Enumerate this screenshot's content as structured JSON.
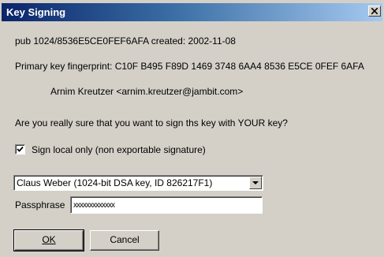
{
  "window": {
    "title": "Key Signing"
  },
  "key": {
    "pub_line": "pub 1024/8536E5CE0FEF6AFA created: 2002-11-08",
    "fingerprint_line": "Primary key fingerprint: C10F B495 F89D 1469 3748 6AA4 8536 E5CE 0FEF 6AFA",
    "user_id": "Arnim Kreutzer <arnim.kreutzer@jambit.com>"
  },
  "question": "Are you really sure that you want to sign ths key with YOUR key?",
  "local_only": {
    "label": "Sign local only (non exportable signature)",
    "checked": true
  },
  "signing_key": {
    "selected": "Claus Weber (1024-bit DSA key, ID 826217F1)"
  },
  "passphrase": {
    "label": "Passphrase",
    "value": "xxxxxxxxxxxxx"
  },
  "buttons": {
    "ok": "OK",
    "cancel": "Cancel"
  },
  "icons": {
    "close": "close-icon",
    "checkmark": "checkmark-icon",
    "dropdown": "chevron-down-icon"
  }
}
